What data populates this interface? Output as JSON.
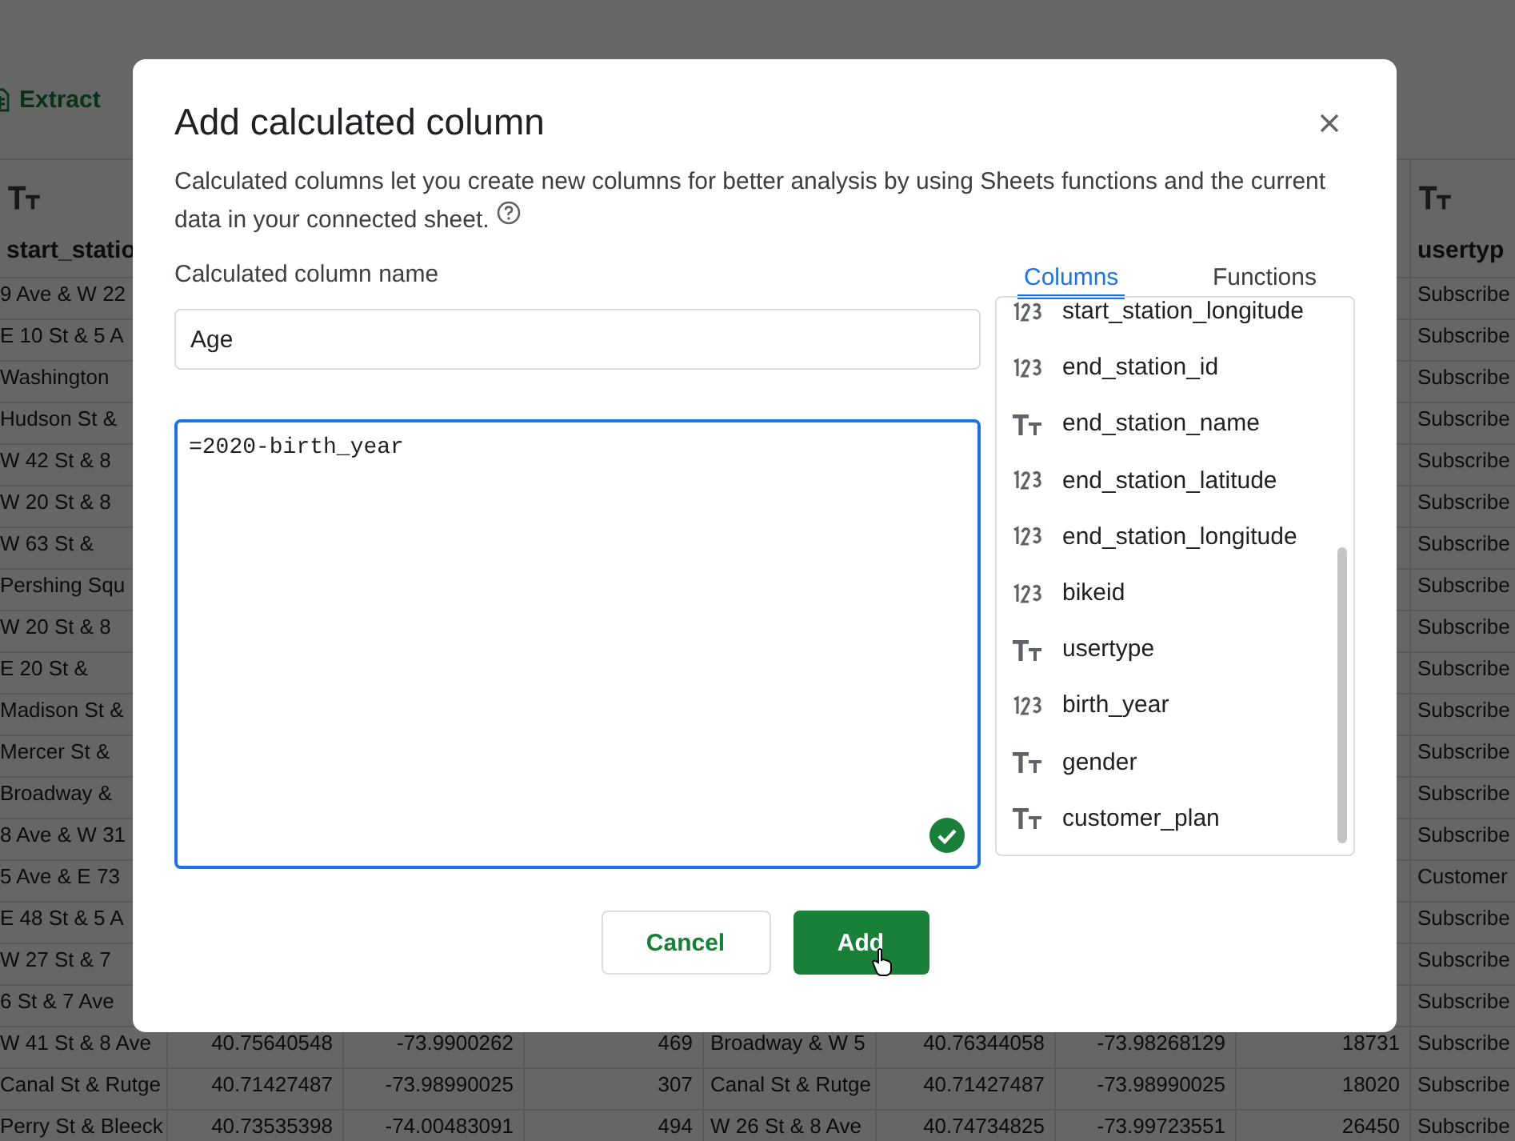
{
  "toolbar": {
    "extract_button": "Extract"
  },
  "sheet": {
    "columns": [
      {
        "kind": "text",
        "label": "start_statio"
      },
      null,
      null,
      null,
      null,
      null,
      null,
      null,
      {
        "kind": "text",
        "label": "usertyp"
      }
    ],
    "rows": [
      {
        "cells": [
          "9 Ave & W 22",
          null,
          null,
          null,
          null,
          null,
          null,
          null,
          "Subscribe"
        ]
      },
      {
        "cells": [
          "E 10 St & 5 A",
          null,
          null,
          null,
          null,
          null,
          null,
          null,
          "Subscribe"
        ]
      },
      {
        "cells": [
          "Washington",
          null,
          null,
          null,
          null,
          null,
          null,
          null,
          "Subscribe"
        ]
      },
      {
        "cells": [
          "Hudson St &",
          null,
          null,
          null,
          null,
          null,
          null,
          null,
          "Subscribe"
        ]
      },
      {
        "cells": [
          "W 42 St & 8",
          null,
          null,
          null,
          null,
          null,
          null,
          null,
          "Subscribe"
        ]
      },
      {
        "cells": [
          "W 20 St & 8",
          null,
          null,
          null,
          null,
          null,
          null,
          null,
          "Subscribe"
        ]
      },
      {
        "cells": [
          "W 63 St &",
          null,
          null,
          null,
          null,
          null,
          null,
          null,
          "Subscribe"
        ]
      },
      {
        "cells": [
          "Pershing Squ",
          null,
          null,
          null,
          null,
          null,
          null,
          null,
          "Subscribe"
        ]
      },
      {
        "cells": [
          "W 20 St & 8",
          null,
          null,
          null,
          null,
          null,
          null,
          null,
          "Subscribe"
        ]
      },
      {
        "cells": [
          "E 20 St &",
          null,
          null,
          null,
          null,
          null,
          null,
          null,
          "Subscribe"
        ]
      },
      {
        "cells": [
          "Madison St &",
          null,
          null,
          null,
          null,
          null,
          null,
          null,
          "Subscribe"
        ]
      },
      {
        "cells": [
          "Mercer St &",
          null,
          null,
          null,
          null,
          null,
          null,
          null,
          "Subscribe"
        ]
      },
      {
        "cells": [
          "Broadway &",
          null,
          null,
          null,
          null,
          null,
          null,
          null,
          "Subscribe"
        ]
      },
      {
        "cells": [
          "8 Ave & W 31",
          null,
          null,
          null,
          null,
          null,
          null,
          null,
          "Subscribe"
        ]
      },
      {
        "cells": [
          "5 Ave & E 73",
          null,
          null,
          null,
          null,
          null,
          null,
          null,
          "Customer"
        ]
      },
      {
        "cells": [
          "E 48 St & 5 A",
          null,
          null,
          null,
          null,
          null,
          null,
          null,
          "Subscribe"
        ]
      },
      {
        "cells": [
          "W 27 St & 7",
          null,
          null,
          null,
          null,
          null,
          null,
          null,
          "Subscribe"
        ]
      },
      {
        "cells": [
          "6 St & 7 Ave",
          null,
          null,
          null,
          null,
          null,
          null,
          null,
          "Subscribe"
        ]
      },
      {
        "cells": [
          "W 41 St & 8 Ave",
          "40.75640548",
          "-73.9900262",
          "469",
          "Broadway & W 5",
          "40.76344058",
          "-73.98268129",
          "18731",
          "Subscribe"
        ]
      },
      {
        "cells": [
          "Canal St & Rutge",
          "40.71427487",
          "-73.98990025",
          "307",
          "Canal St & Rutge",
          "40.71427487",
          "-73.98990025",
          "18020",
          "Subscribe"
        ]
      },
      {
        "cells": [
          "Perry St & Bleeck",
          "40.73535398",
          "-74.00483091",
          "494",
          "W 26 St & 8 Ave",
          "40.74734825",
          "-73.99723551",
          "26450",
          "Subscribe"
        ]
      }
    ]
  },
  "dialog": {
    "title": "Add calculated column",
    "description": "Calculated columns let you create new columns for better analysis by using Sheets functions and the current data in your connected sheet.",
    "name_label": "Calculated column name",
    "name_value": "Age",
    "formula": "=2020-birth_year",
    "formula_valid": true,
    "tabs": [
      {
        "label": "Columns",
        "selected": true
      },
      {
        "label": "Functions",
        "selected": false
      }
    ],
    "column_list": [
      {
        "kind": "number",
        "name": "start_station_longitude"
      },
      {
        "kind": "number",
        "name": "end_station_id"
      },
      {
        "kind": "text",
        "name": "end_station_name"
      },
      {
        "kind": "number",
        "name": "end_station_latitude"
      },
      {
        "kind": "number",
        "name": "end_station_longitude"
      },
      {
        "kind": "number",
        "name": "bikeid"
      },
      {
        "kind": "text",
        "name": "usertype"
      },
      {
        "kind": "number",
        "name": "birth_year"
      },
      {
        "kind": "text",
        "name": "gender"
      },
      {
        "kind": "text",
        "name": "customer_plan"
      }
    ],
    "buttons": [
      {
        "kind": "secondary",
        "label": "Cancel"
      },
      {
        "kind": "primary",
        "label": "Add"
      }
    ]
  }
}
